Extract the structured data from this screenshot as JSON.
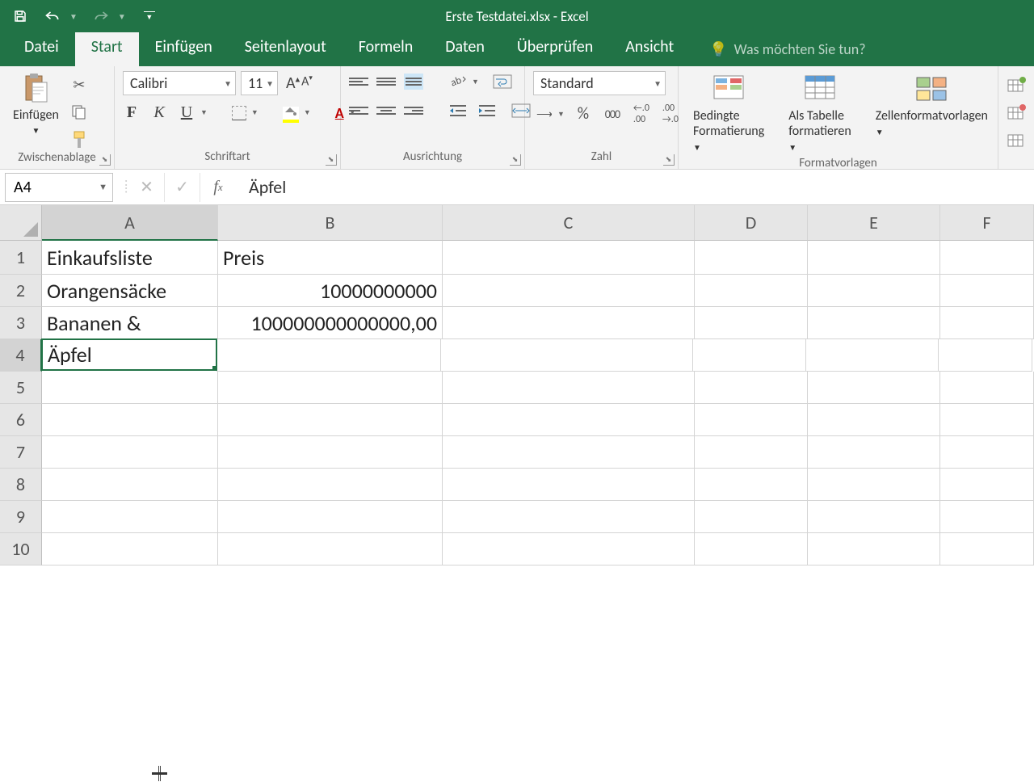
{
  "title": "Erste Testdatei.xlsx - Excel",
  "tabs": {
    "file": "Datei",
    "home": "Start",
    "insert": "Einfügen",
    "pagelayout": "Seitenlayout",
    "formulas": "Formeln",
    "data": "Daten",
    "review": "Überprüfen",
    "view": "Ansicht",
    "tellme": "Was möchten Sie tun?"
  },
  "ribbon": {
    "clipboard": {
      "label": "Zwischenablage",
      "paste": "Einfügen"
    },
    "font": {
      "label": "Schriftart",
      "name": "Calibri",
      "size": "11",
      "bold": "F",
      "italic": "K",
      "underline": "U"
    },
    "alignment": {
      "label": "Ausrichtung"
    },
    "number": {
      "label": "Zahl",
      "format": "Standard",
      "percent": "%",
      "comma": "000"
    },
    "styles": {
      "label": "Formatvorlagen",
      "cond": "Bedingte Formatierung",
      "table": "Als Tabelle formatieren",
      "cellstyles": "Zellenformatvorlagen"
    }
  },
  "formula_bar": {
    "name_box": "A4",
    "formula": "Äpfel"
  },
  "columns": [
    "A",
    "B",
    "C",
    "D",
    "E",
    "F"
  ],
  "rows": [
    "1",
    "2",
    "3",
    "4",
    "5",
    "6",
    "7",
    "8",
    "9",
    "10"
  ],
  "cells": {
    "A1": "Einkaufsliste",
    "B1": "Preis",
    "A2": "Orangensäcke",
    "B2": "10000000000",
    "A3": "Bananen &",
    "B3": "100000000000000,00",
    "A4": "Äpfel"
  },
  "selected_cell": "A4"
}
